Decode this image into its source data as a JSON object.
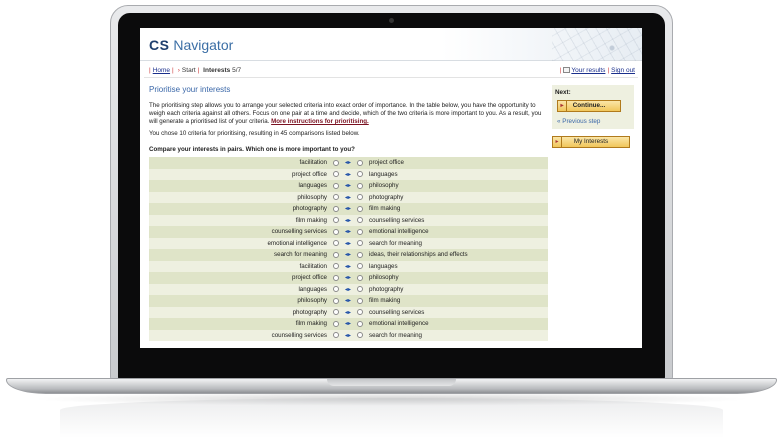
{
  "site": {
    "logo_bold": "CS",
    "logo_rest": "Navigator"
  },
  "breadcrumb": {
    "home": "Home",
    "start": "Start",
    "current": "Interests",
    "progress": "5/7"
  },
  "top_links": {
    "results": "Your results",
    "signout": "Sign out"
  },
  "main": {
    "title": "Prioritise your interests",
    "intro": "The prioritising step allows you to arrange your selected criteria into exact order of importance. In the table below, you have the opportunity to weigh each criteria against all others. Focus on one pair at a time and decide, which of the two criteria is more important to you. As a result, you will generate a prioritised list of your criteria.",
    "instructions_link": "More instructions for prioritising.",
    "count_line": "You chose 10 criteria for prioritising, resulting in 45 comparisons listed below.",
    "question": "Compare your interests in pairs. Which one is more important to you?",
    "pairs": [
      {
        "left": "facilitation",
        "right": "project office"
      },
      {
        "left": "project office",
        "right": "languages"
      },
      {
        "left": "languages",
        "right": "philosophy"
      },
      {
        "left": "philosophy",
        "right": "photography"
      },
      {
        "left": "photography",
        "right": "film making"
      },
      {
        "left": "film making",
        "right": "counselling services"
      },
      {
        "left": "counselling services",
        "right": "emotional intelligence"
      },
      {
        "left": "emotional intelligence",
        "right": "search for meaning"
      },
      {
        "left": "search for meaning",
        "right": "ideas, their relationships and effects"
      },
      {
        "left": "facilitation",
        "right": "languages"
      },
      {
        "left": "project office",
        "right": "philosophy"
      },
      {
        "left": "languages",
        "right": "photography"
      },
      {
        "left": "philosophy",
        "right": "film making"
      },
      {
        "left": "photography",
        "right": "counselling services"
      },
      {
        "left": "film making",
        "right": "emotional intelligence"
      },
      {
        "left": "counselling services",
        "right": "search for meaning"
      }
    ]
  },
  "sidebar": {
    "next_label": "Next:",
    "continue_button": "Continue...",
    "previous_link": "« Previous step",
    "interests_button": "My Interests"
  }
}
